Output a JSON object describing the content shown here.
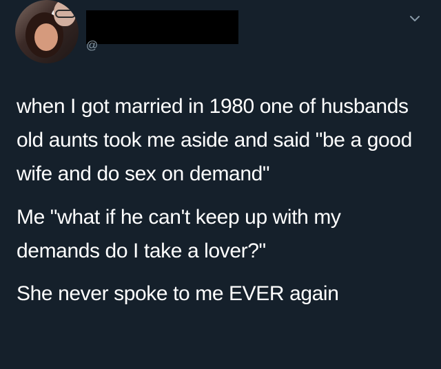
{
  "tweet": {
    "handle": "@",
    "paragraphs": [
      "when I got married in 1980 one of husbands old aunts took me aside and said  \"be a good wife and do sex on demand\"",
      "Me \"what if he can't keep up with my demands do I take a lover?\"",
      "She never spoke to me EVER again"
    ]
  },
  "colors": {
    "background": "#15202b",
    "text": "#ffffff",
    "secondary": "#8899a6"
  },
  "icons": {
    "menu": "chevron-down-icon"
  }
}
